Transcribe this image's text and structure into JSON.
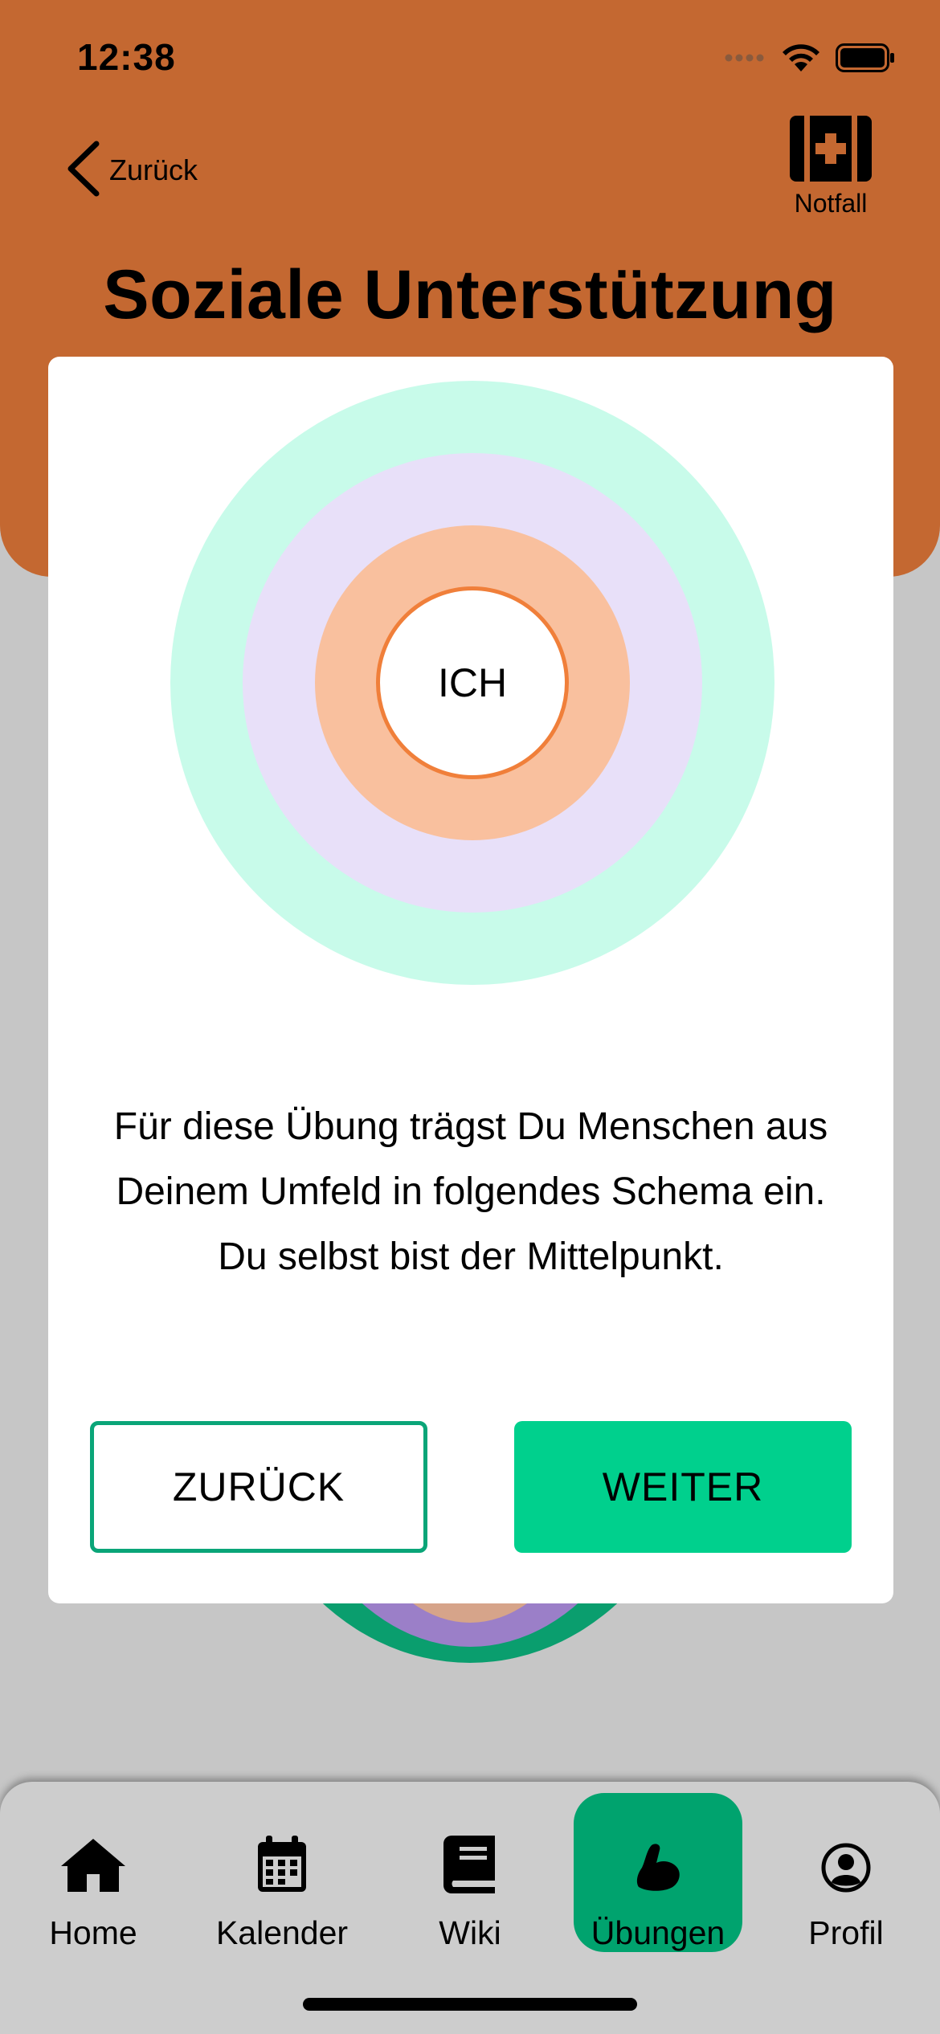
{
  "status_bar": {
    "time": "12:38",
    "icons": [
      "signal-icon",
      "wifi-icon",
      "battery-icon"
    ]
  },
  "header": {
    "back_label": "Zurück",
    "emergency_label": "Notfall",
    "title": "Soziale Unterstützung",
    "background_color": "#c46831"
  },
  "card": {
    "center_label": "ICH",
    "ring_colors": [
      "#c8fbea",
      "#e8e0f9",
      "#f9c09e",
      "#ffffff"
    ],
    "description": "Für diese Übung trägst Du Menschen aus Deinem Umfeld in folgendes Schema ein. Du selbst bist der Mittelpunkt.",
    "back_button": "ZURÜCK",
    "next_button": "WEITER",
    "accent_color": "#00d08d"
  },
  "tabbar": {
    "items": [
      {
        "label": "Home",
        "icon": "home-icon"
      },
      {
        "label": "Kalender",
        "icon": "calendar-icon"
      },
      {
        "label": "Wiki",
        "icon": "book-icon"
      },
      {
        "label": "Übungen",
        "icon": "muscle-icon",
        "active": true
      },
      {
        "label": "Profil",
        "icon": "profile-icon"
      }
    ],
    "active_color": "#00a36e"
  }
}
